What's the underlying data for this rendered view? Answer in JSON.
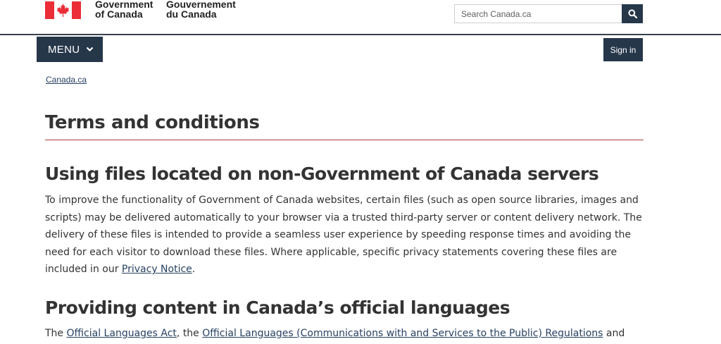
{
  "header": {
    "signature_en_line1": "Government",
    "signature_en_line2": "of Canada",
    "signature_fr_line1": "Gouvernement",
    "signature_fr_line2": "du Canada",
    "search_placeholder": "Search Canada.ca",
    "flag_color": "#eb2d37"
  },
  "nav": {
    "menu_label": "MENU",
    "signin_label": "Sign in"
  },
  "breadcrumb": {
    "item": "Canada.ca"
  },
  "main": {
    "title": "Terms and conditions",
    "section1": {
      "heading": "Using files located on non-Government of Canada servers",
      "text": "To improve the functionality of Government of Canada websites, certain files (such as open source libraries, images and scripts) may be delivered automatically to your browser via a trusted third-party server or content delivery network. The delivery of these files is intended to provide a seamless user experience by speeding response times and avoiding the need for each visitor to download these files. Where applicable, specific privacy statements covering these files are included in our ",
      "link": "Privacy Notice",
      "end": "."
    },
    "section2": {
      "heading": "Providing content in Canada’s official languages",
      "text_start": "The ",
      "link1": "Official Languages Act",
      "text_mid": ", the ",
      "link2": "Official Languages (Communications with and Services to the Public) Regulations",
      "text_end": " and"
    }
  },
  "colors": {
    "accent": "#26374a",
    "link": "#284162",
    "rule": "#af3c43"
  }
}
